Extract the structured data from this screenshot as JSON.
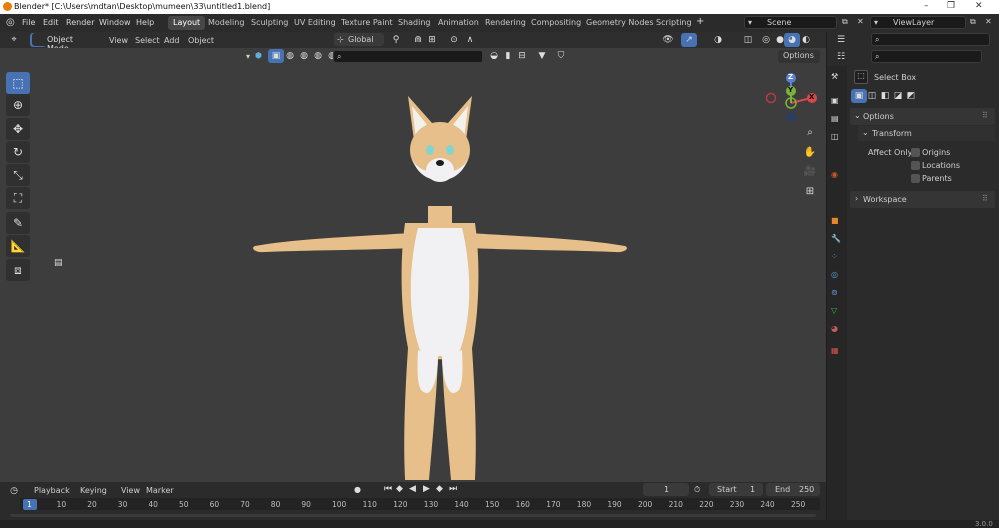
{
  "window": {
    "title": "Blender* [C:\\Users\\mdtan\\Desktop\\mumeen\\33\\untitled1.blend]",
    "minimize": "–",
    "maximize": "❐",
    "close": "✕"
  },
  "menu": [
    "File",
    "Edit",
    "Render",
    "Window",
    "Help"
  ],
  "workspaces": [
    "Layout",
    "Modeling",
    "Sculpting",
    "UV Editing",
    "Texture Paint",
    "Shading",
    "Animation",
    "Rendering",
    "Compositing",
    "Geometry Nodes",
    "Scripting"
  ],
  "add_workspace": "+",
  "scene": {
    "label": "Scene"
  },
  "viewlayer": {
    "label": "ViewLayer"
  },
  "viewport_header": {
    "mode": "Object Mode",
    "menus": [
      "View",
      "Select",
      "Add",
      "Object"
    ],
    "orientation": "Global",
    "options": "Options"
  },
  "gizmo": {
    "z": "Z",
    "y": "Y",
    "x": "X"
  },
  "timeline": {
    "playback": "Playback",
    "keying": "Keying",
    "view": "View",
    "marker": "Marker",
    "current_frame": "1",
    "start_label": "Start",
    "start": "1",
    "end_label": "End",
    "end": "250",
    "ticks": [
      "1",
      "10",
      "20",
      "30",
      "40",
      "50",
      "60",
      "70",
      "80",
      "90",
      "100",
      "110",
      "120",
      "130",
      "140",
      "150",
      "160",
      "170",
      "180",
      "190",
      "200",
      "210",
      "220",
      "230",
      "240",
      "250"
    ]
  },
  "properties": {
    "tool_name": "Select Box",
    "options": "Options",
    "transform": "Transform",
    "affect_only": "Affect Only",
    "origins": "Origins",
    "locations": "Locations",
    "parents": "Parents",
    "workspace": "Workspace"
  },
  "version": "3.0.0",
  "colors": {
    "accent": "#4772b3",
    "fur_tan": "#e8c28e",
    "fur_white": "#f2f2f4",
    "eye": "#7fd6cf"
  }
}
